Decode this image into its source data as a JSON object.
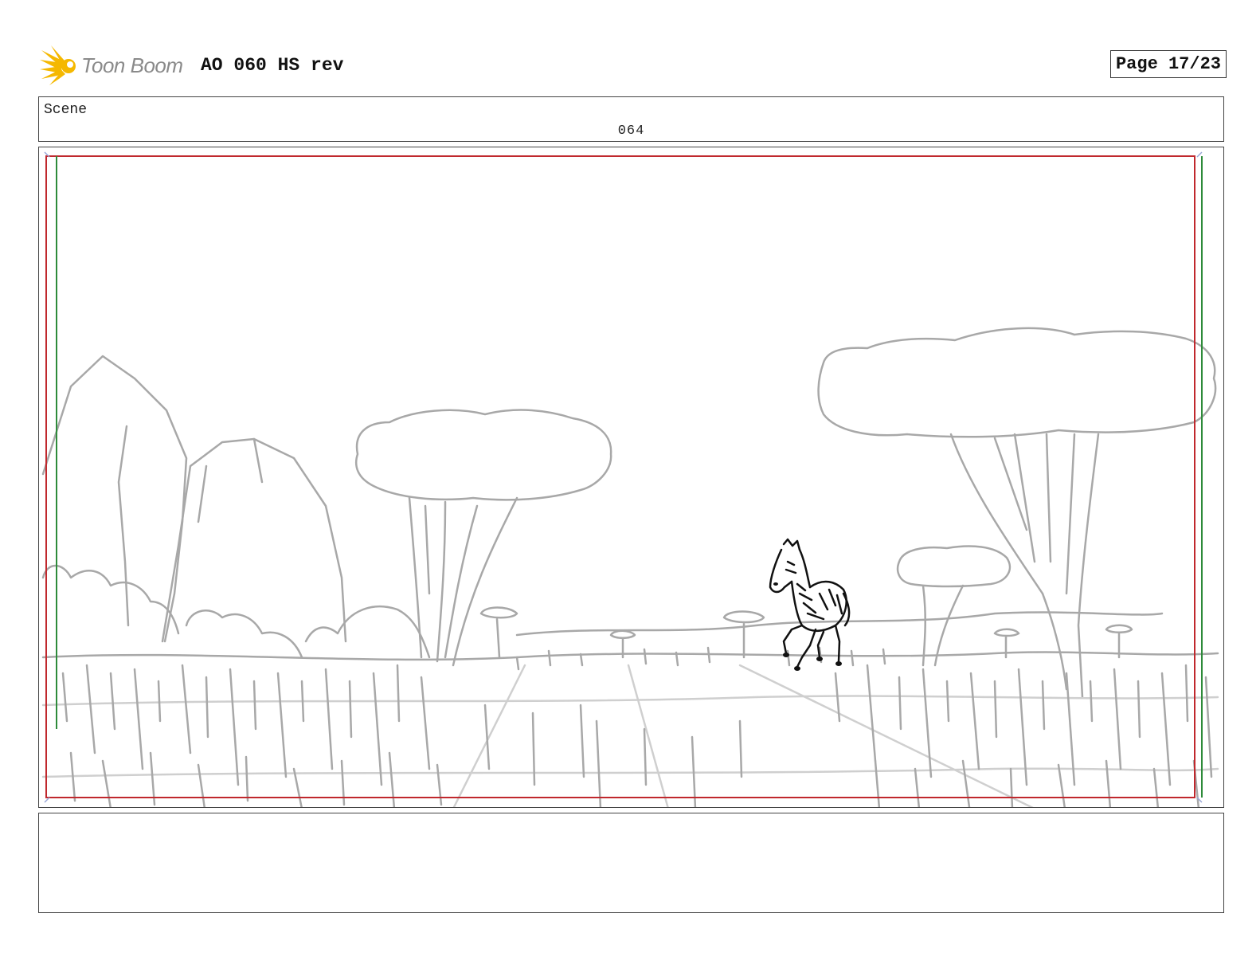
{
  "header": {
    "logo_text": "Toon Boom",
    "title": "AO 060 HS rev",
    "page_label": "Page 17/23"
  },
  "scene": {
    "label": "Scene",
    "number": "064"
  },
  "notes": {
    "text": ""
  },
  "colors": {
    "logo_accent": "#f5b800",
    "sketch": "#a8a8a8",
    "character_ink": "#111111",
    "frame_red": "#c0282d",
    "frame_green": "#2e8b3a"
  },
  "icons": {
    "logo": "starburst-logo-icon"
  }
}
